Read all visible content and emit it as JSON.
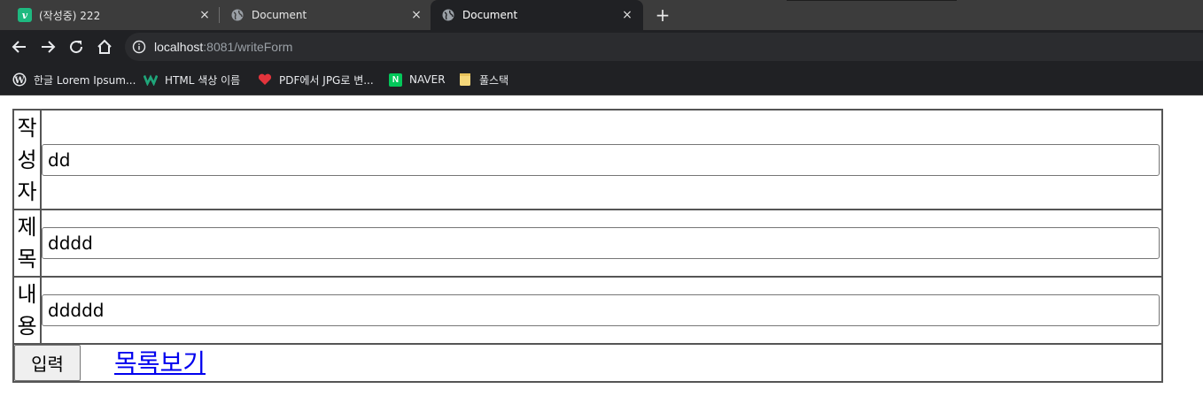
{
  "browser": {
    "tabs": [
      {
        "title": "(작성중) 222",
        "favicon": "velog-v-icon",
        "favicon_text": "v"
      },
      {
        "title": "Document",
        "favicon": "globe-icon"
      },
      {
        "title": "Document",
        "favicon": "globe-icon",
        "active": true
      }
    ],
    "tab_close_glyph": "×",
    "new_tab_glyph": "+",
    "url": {
      "host": "localhost",
      "rest": ":8081/writeForm"
    },
    "bookmarks": [
      {
        "label": "한글 Lorem Ipsum...",
        "icon": "wordpress-icon"
      },
      {
        "label": "HTML 색상 이름",
        "icon": "w-logo-icon"
      },
      {
        "label": "PDF에서 JPG로 변...",
        "icon": "heart-icon"
      },
      {
        "label": "NAVER",
        "icon": "naver-icon",
        "icon_text": "N"
      },
      {
        "label": "풀스택",
        "icon": "folder-icon"
      }
    ]
  },
  "form": {
    "writer": {
      "label": "작성자",
      "value": "dd"
    },
    "title": {
      "label": "제목",
      "value": "dddd"
    },
    "content": {
      "label": "내용",
      "value": "ddddd"
    },
    "submit_label": "입력",
    "list_link": "목록보기"
  },
  "colors": {
    "tabbar": "#3c3c3c",
    "toolbar": "#202124",
    "link": "#0000ee",
    "velog_green": "#1eb980",
    "naver_green": "#03c75a"
  }
}
